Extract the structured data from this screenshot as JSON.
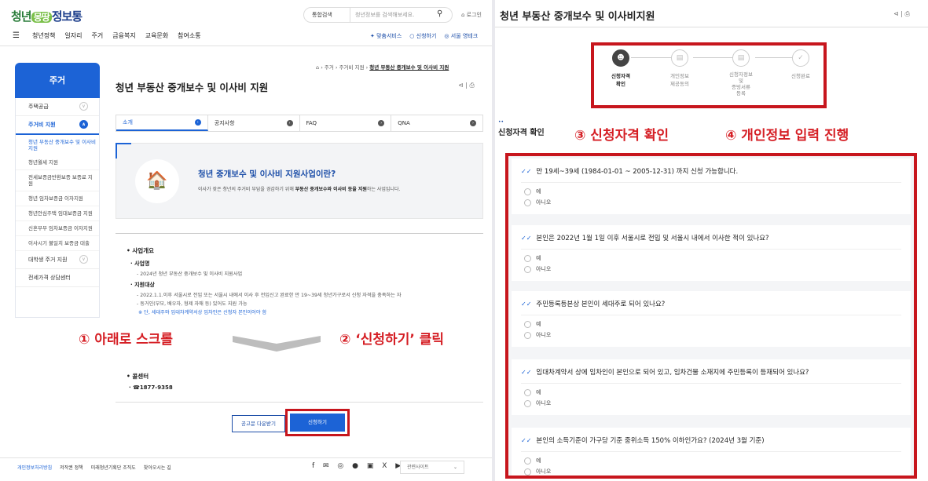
{
  "left": {
    "logo": {
      "part1": "청년",
      "part2": "몽땅",
      "part3": "정보통"
    },
    "search": {
      "select": "통합검색",
      "placeholder": "청년정보를 검색해보세요."
    },
    "login": "로그인",
    "gnb": [
      "청년정책",
      "일자리",
      "주거",
      "금융복지",
      "교육문화",
      "참여소통"
    ],
    "util": [
      "맞춤서비스",
      "신청하기",
      "서울 영테크"
    ],
    "sidebar": {
      "title": "주거",
      "items": [
        {
          "label": "주택공급",
          "type": "top",
          "toggle": "∨"
        },
        {
          "label": "주거비 지원",
          "type": "top-active",
          "toggle": "∧"
        },
        {
          "label": "청년 부동산 중개보수 및 이사비 지원",
          "type": "sub-active"
        },
        {
          "label": "청년월세 지원",
          "type": "sub"
        },
        {
          "label": "전세보증금반환보증 보증료 지원",
          "type": "sub"
        },
        {
          "label": "청년 임차보증금 이자지원",
          "type": "sub"
        },
        {
          "label": "청년안심주택 임대보증금 지원",
          "type": "sub"
        },
        {
          "label": "신혼부부 임차보증금 이자지원",
          "type": "sub"
        },
        {
          "label": "이사시기 불일치 보증금 대출",
          "type": "sub"
        },
        {
          "label": "대학생 주거 지원",
          "type": "top",
          "toggle": "∨"
        },
        {
          "label": "전세가격 상담센터",
          "type": "top"
        }
      ]
    },
    "breadcrumb": [
      "주거",
      "주거비 지원",
      "청년 부동산 중개보수 및 이사비 지원"
    ],
    "page_title": "청년 부동산 중개보수 및 이사비 지원",
    "tabs": [
      "소개",
      "공지사항",
      "FAQ",
      "QNA"
    ],
    "intro": {
      "title": "청년 중개보수 및 이사비 지원사업이란?",
      "desc_plain": "이사가 잦은 청년의 주거비 부담을 경감하기 위해 ",
      "desc_bold": "부동산 중개보수와 이사비 등을 지원",
      "desc_end": "하는 사업입니다."
    },
    "overview": {
      "heading": "사업개요",
      "name_label": "사업명",
      "name_text": "- 2024년 청년 부동산 중개보수 및 이사비 지원사업",
      "target_label": "지원대상",
      "target_text1": "- 2022.1.1.이후 서울시로 전입 또는 서울시 내에서 이사 후 전입신고 완료한 만 19~39세 청년가구로서 신청 자격을 충족하는 자",
      "target_text2": "- 동거인(부모, 배우자, 형제 자매 등) 있어도 지원 가능",
      "target_note": "※ 단, 세대주와 임대차계약서상 임차인은 신청자 본인이어야 함"
    },
    "call": {
      "heading": "콜센터",
      "number": "· ☎1877-9358"
    },
    "buttons": {
      "download": "공고문 다운받기",
      "apply": "신청하기"
    },
    "footer": {
      "links": [
        "개인정보처리방침",
        "저작권 정책",
        "미래청년기획단 조직도",
        "찾아오시는 길"
      ],
      "social": "f ✉ ◎ ● ▣ X ▶",
      "related": "관련사이트"
    }
  },
  "annotations": {
    "step1": "① 아래로 스크롤",
    "step2": "② ‘신청하기’ 클릭",
    "step3": "③ 신청자격 확인",
    "step4": "④ 개인정보 입력 진행"
  },
  "right": {
    "title": "청년 부동산 중개보수 및 이사비지원",
    "steps": [
      {
        "label": "신청자격\n확인",
        "icon": "person-icon"
      },
      {
        "label": "개인정보\n제공동의",
        "icon": "card-icon"
      },
      {
        "label": "신청자정보\n및\n증빙서류\n등록",
        "icon": "document-icon"
      },
      {
        "label": "신청완료",
        "icon": "check-icon"
      }
    ],
    "section": "신청자격 확인",
    "questions": [
      "만 19세~39세 (1984-01-01 ~ 2005-12-31) 까지 신청 가능합니다.",
      "본인은 2022년 1월 1일 이후 서울시로 전입 및 서울시 내에서 이사한 적이 있나요?",
      "주민등록등본상 본인이 세대주로 되어 있나요?",
      "임대차계약서 상에 임차인이 본인으로 되어 있고, 임차건물 소재지에 주민등록이 등재되어 있나요?",
      "본인의 소득기준이 가구당 기준 중위소득 150% 이하인가요? (2024년 3월 기준)"
    ],
    "options": [
      "예",
      "아니오"
    ]
  },
  "colors": {
    "accent": "#1c63d6",
    "annotation": "#d51e24",
    "highlight_box": "#c7161d"
  }
}
